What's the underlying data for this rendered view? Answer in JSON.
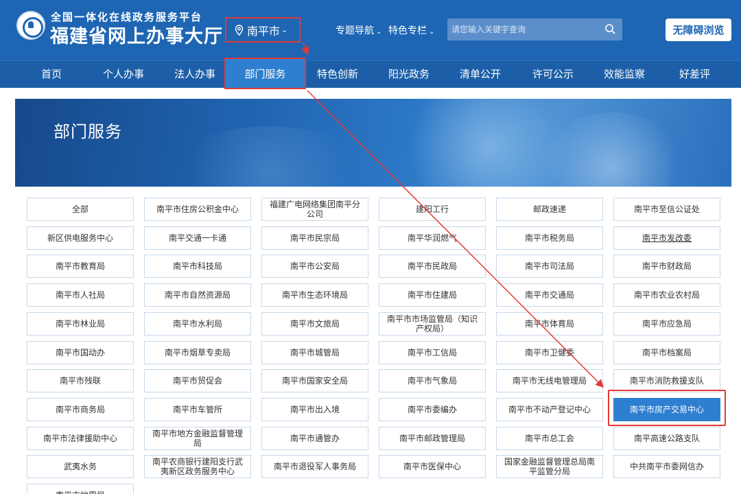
{
  "header": {
    "logo_sub": "全国一体化在线政务服务平台",
    "logo_main": "福建省网上办事大厅",
    "city": "南平市",
    "topnav": [
      "专题导航",
      "特色专栏"
    ],
    "search_placeholder": "请您输入关键字查询",
    "access_button": "无障碍浏览"
  },
  "mainnav": {
    "items": [
      "首页",
      "个人办事",
      "法人办事",
      "部门服务",
      "特色创新",
      "阳光政务",
      "清单公开",
      "许可公示",
      "效能监察",
      "好差评"
    ],
    "active": "部门服务"
  },
  "banner": {
    "title": "部门服务"
  },
  "departments": [
    "全部",
    "南平市住房公积金中心",
    "福建广电网络集团南平分公司",
    "建阳工行",
    "邮政速递",
    "南平市至信公证处",
    "新区供电服务中心",
    "南平交通一卡通",
    "南平市民宗局",
    "南平华润燃气",
    "南平市税务局",
    "南平市发改委",
    "南平市教育局",
    "南平市科技局",
    "南平市公安局",
    "南平市民政局",
    "南平市司法局",
    "南平市财政局",
    "南平市人社局",
    "南平市自然资源局",
    "南平市生态环境局",
    "南平市住建局",
    "南平市交通局",
    "南平市农业农村局",
    "南平市林业局",
    "南平市水利局",
    "南平市文旅局",
    "南平市市场监管局（知识产权局）",
    "南平市体育局",
    "南平市应急局",
    "南平市国动办",
    "南平市烟草专卖局",
    "南平市城管局",
    "南平市工信局",
    "南平市卫健委",
    "南平市档案局",
    "南平市残联",
    "南平市贸促会",
    "南平市国家安全局",
    "南平市气象局",
    "南平市无线电管理局",
    "南平市消防救援支队",
    "南平市商务局",
    "南平市车管所",
    "南平市出入境",
    "南平市委编办",
    "南平市不动产登记中心",
    "南平市房产交易中心",
    "南平市法律援助中心",
    "南平市地方金融监督管理局",
    "南平市通管办",
    "南平市邮政管理局",
    "南平市总工会",
    "南平高速公路支队",
    "武夷水务",
    "南平农商银行建阳支行武夷新区政务服务中心",
    "南平市退役军人事务局",
    "南平市医保中心",
    "国家金融监督管理总局南平监管分局",
    "中共南平市委网信办",
    "南平市地震局"
  ],
  "selected_department": "南平市房产交易中心",
  "underlined_department": "南平市发改委",
  "colors": {
    "header_bg": "#1e66b3",
    "nav_bg": "#1c5fa8",
    "active_bg": "#2f7fd0",
    "annotation": "#e53935",
    "tile_border": "#c7d8ea"
  }
}
